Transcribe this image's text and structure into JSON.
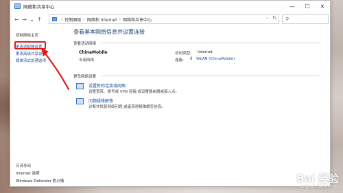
{
  "window": {
    "title": "网络和共享中心",
    "controls": [
      "—",
      "☐",
      "✕"
    ]
  },
  "addressbar": {
    "back": "←",
    "forward": "→",
    "recent": "⌄",
    "up": "↑",
    "breadcrumbs": [
      "控制面板",
      "网络和 Internet",
      "网络和共享中心"
    ],
    "dropdown": "⌄",
    "refresh": "↻",
    "search_icon": "⚲"
  },
  "sidebar": {
    "home": "控制面板主页",
    "links": [
      "更改适配器设置",
      "更改高级共享设置",
      "媒体流式处理选项"
    ],
    "see_also_title": "另请参阅",
    "see_also": [
      "Internet 选项",
      "Windows Defender 防火墙"
    ]
  },
  "main": {
    "heading": "查看基本网络信息并设置连接",
    "active_networks_label": "查看活动网络",
    "network": {
      "name": "ChinaMobile",
      "type": "专用网络",
      "access_type_label": "访问类型:",
      "access_type_value": "Internet",
      "connection_label": "连接:",
      "connection_value": "WLAN (ChinaMobile)"
    },
    "change_settings_label": "更改网络设置",
    "settings": [
      {
        "link": "设置新的连接或网络",
        "desc": "设置宽带、拨号或 VPN 连接;或设置路由器或接入点。",
        "icon": "network-setup-icon"
      },
      {
        "link": "问题疑难解答",
        "desc": "诊断并修复网络问题,或者获得疑难解答信息。",
        "icon": "troubleshoot-icon"
      }
    ]
  },
  "colors": {
    "link": "#1a4fa0",
    "heading": "#1e3c78",
    "highlight": "#e01b1b"
  },
  "watermark": {
    "text": "Bai 经验",
    "sub": "jingyan.baidu.com"
  }
}
